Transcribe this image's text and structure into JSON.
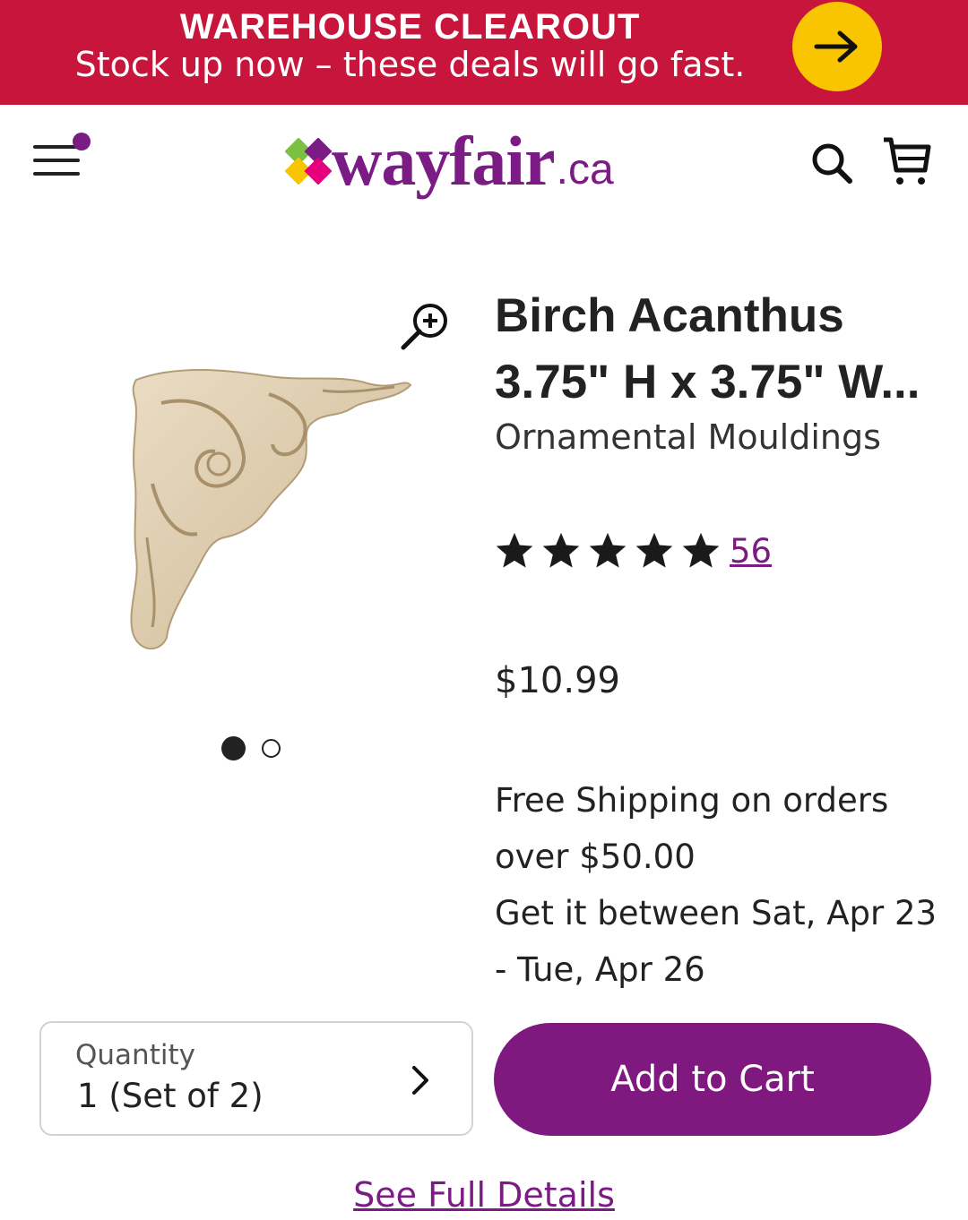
{
  "promo": {
    "title": "WAREHOUSE CLEAROUT",
    "subtitle": "Stock up now – these deals will go fast.",
    "button_icon": "arrow-right-icon",
    "background_color": "#c7153c",
    "button_color": "#f8c500"
  },
  "header": {
    "menu_icon": "hamburger-menu-icon",
    "logo_text": "wayfair",
    "logo_suffix": ".ca",
    "search_icon": "search-icon",
    "cart_icon": "cart-icon"
  },
  "product": {
    "title_line1": "Birch Acanthus",
    "title_line2": "3.75\" H x 3.75\" W...",
    "brand": "Ornamental Mouldings",
    "rating_stars": 5,
    "review_count": "56",
    "price": "$10.99",
    "shipping_line1": "Free Shipping on orders",
    "shipping_line2": "over $50.00",
    "delivery_line1": "Get it between Sat, Apr 23",
    "delivery_line2": "- Tue, Apr 26",
    "image_pages": 2,
    "image_current": 1
  },
  "quantity": {
    "label": "Quantity",
    "value": "1 (Set of 2)"
  },
  "actions": {
    "add_to_cart": "Add to Cart",
    "see_details": "See Full Details"
  },
  "colors": {
    "brand_purple": "#7a1c84",
    "button_purple": "#7f187f"
  }
}
